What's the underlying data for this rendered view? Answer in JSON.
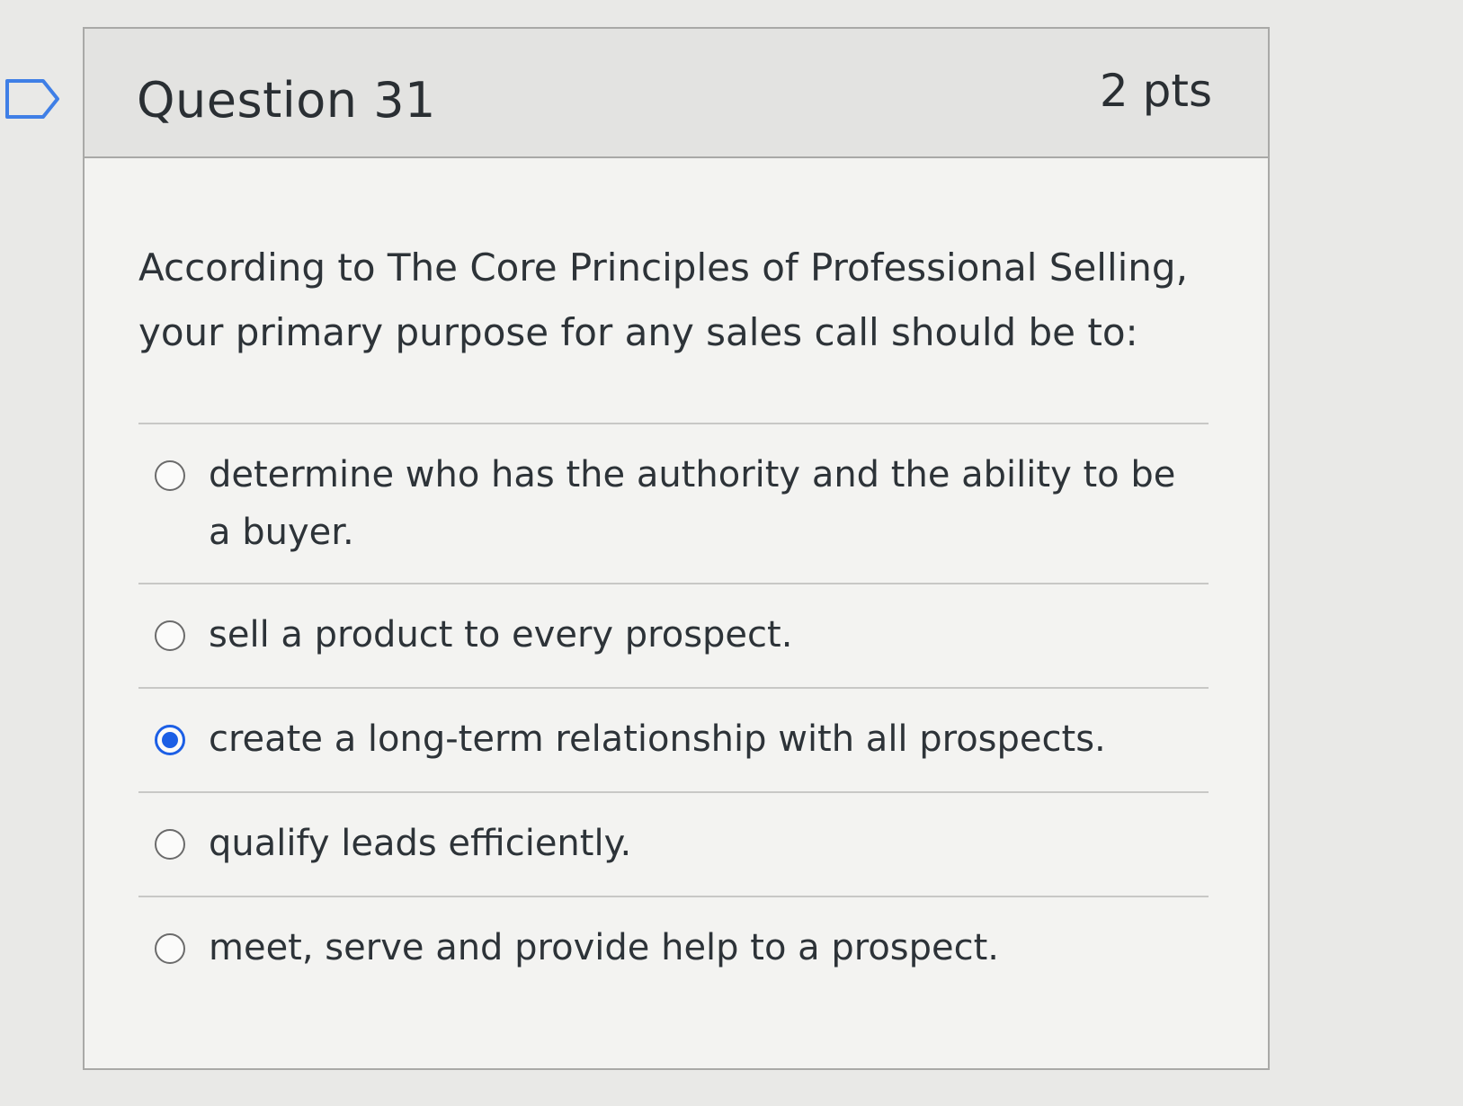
{
  "question": {
    "title": "Question 31",
    "points": "2 pts",
    "text": "According to The Core Principles of Professional Selling, your primary purpose for any sales call should be to:",
    "flag_icon": "bookmark-flag-outline"
  },
  "answers": [
    {
      "label": "determine who has the authority and the ability to be a buyer.",
      "selected": false
    },
    {
      "label": "sell a product to every prospect.",
      "selected": false
    },
    {
      "label": "create a long-term relationship with all prospects.",
      "selected": true
    },
    {
      "label": "qualify leads efficiently.",
      "selected": false
    },
    {
      "label": "meet, serve and provide help to a prospect.",
      "selected": false
    }
  ],
  "colors": {
    "accent": "#1c5fe5",
    "border": "#a9a9a7",
    "header_bg": "#e3e3e1"
  }
}
